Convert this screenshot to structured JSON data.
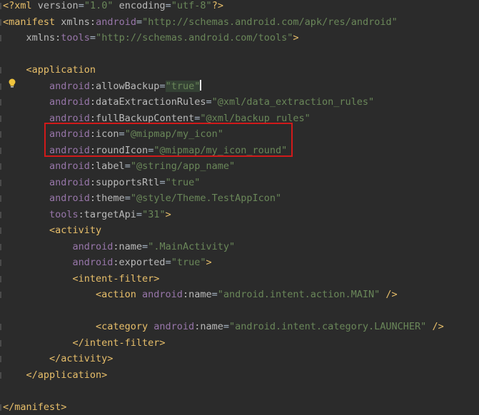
{
  "editor": {
    "lines": [
      {
        "indent": 0,
        "segments": [
          {
            "t": "<?xml ",
            "c": "tok-pi"
          },
          {
            "t": "version",
            "c": "tok-attr"
          },
          {
            "t": "=",
            "c": "tok-punct"
          },
          {
            "t": "\"1.0\"",
            "c": "tok-val"
          },
          {
            "t": " ",
            "c": "tok-punct"
          },
          {
            "t": "encoding",
            "c": "tok-attr"
          },
          {
            "t": "=",
            "c": "tok-punct"
          },
          {
            "t": "\"utf-8\"",
            "c": "tok-val"
          },
          {
            "t": "?>",
            "c": "tok-pi"
          }
        ]
      },
      {
        "indent": 0,
        "segments": [
          {
            "t": "<manifest ",
            "c": "tok-tag"
          },
          {
            "t": "xmlns:",
            "c": "tok-attr"
          },
          {
            "t": "android",
            "c": "tok-ns"
          },
          {
            "t": "=",
            "c": "tok-punct"
          },
          {
            "t": "\"http://schemas.android.com/apk/res/android\"",
            "c": "tok-val"
          }
        ]
      },
      {
        "indent": 1,
        "segments": [
          {
            "t": "xmlns:",
            "c": "tok-attr"
          },
          {
            "t": "tools",
            "c": "tok-ns"
          },
          {
            "t": "=",
            "c": "tok-punct"
          },
          {
            "t": "\"http://schemas.android.com/tools\"",
            "c": "tok-val"
          },
          {
            "t": ">",
            "c": "tok-tag"
          }
        ]
      },
      {
        "indent": 0,
        "segments": []
      },
      {
        "indent": 1,
        "segments": [
          {
            "t": "<application",
            "c": "tok-tag"
          }
        ]
      },
      {
        "indent": 2,
        "segments": [
          {
            "t": "android",
            "c": "tok-ns"
          },
          {
            "t": ":allowBackup",
            "c": "tok-attr"
          },
          {
            "t": "=",
            "c": "tok-punct"
          },
          {
            "t": "\"true\"",
            "c": "tok-val caret-hl"
          },
          {
            "t": "",
            "c": "caret"
          }
        ]
      },
      {
        "indent": 2,
        "segments": [
          {
            "t": "android",
            "c": "tok-ns"
          },
          {
            "t": ":dataExtractionRules",
            "c": "tok-attr"
          },
          {
            "t": "=",
            "c": "tok-punct"
          },
          {
            "t": "\"@xml/data_extraction_rules\"",
            "c": "tok-val"
          }
        ]
      },
      {
        "indent": 2,
        "segments": [
          {
            "t": "android",
            "c": "tok-ns"
          },
          {
            "t": ":fullBackupContent",
            "c": "tok-attr"
          },
          {
            "t": "=",
            "c": "tok-punct"
          },
          {
            "t": "\"@xml/backup_rules\"",
            "c": "tok-val"
          }
        ]
      },
      {
        "indent": 2,
        "segments": [
          {
            "t": "android",
            "c": "tok-ns"
          },
          {
            "t": ":icon",
            "c": "tok-attr"
          },
          {
            "t": "=",
            "c": "tok-punct"
          },
          {
            "t": "\"@mipmap/my_icon\"",
            "c": "tok-val"
          }
        ]
      },
      {
        "indent": 2,
        "segments": [
          {
            "t": "android",
            "c": "tok-ns"
          },
          {
            "t": ":roundIcon",
            "c": "tok-attr"
          },
          {
            "t": "=",
            "c": "tok-punct"
          },
          {
            "t": "\"@mipmap/my_icon_round\"",
            "c": "tok-val"
          }
        ]
      },
      {
        "indent": 2,
        "segments": [
          {
            "t": "android",
            "c": "tok-ns"
          },
          {
            "t": ":label",
            "c": "tok-attr"
          },
          {
            "t": "=",
            "c": "tok-punct"
          },
          {
            "t": "\"@string/app_name\"",
            "c": "tok-val"
          }
        ]
      },
      {
        "indent": 2,
        "segments": [
          {
            "t": "android",
            "c": "tok-ns"
          },
          {
            "t": ":supportsRtl",
            "c": "tok-attr"
          },
          {
            "t": "=",
            "c": "tok-punct"
          },
          {
            "t": "\"true\"",
            "c": "tok-val"
          }
        ]
      },
      {
        "indent": 2,
        "segments": [
          {
            "t": "android",
            "c": "tok-ns"
          },
          {
            "t": ":theme",
            "c": "tok-attr"
          },
          {
            "t": "=",
            "c": "tok-punct"
          },
          {
            "t": "\"@style/Theme.TestAppIcon\"",
            "c": "tok-val"
          }
        ]
      },
      {
        "indent": 2,
        "segments": [
          {
            "t": "tools",
            "c": "tok-ns"
          },
          {
            "t": ":targetApi",
            "c": "tok-attr"
          },
          {
            "t": "=",
            "c": "tok-punct"
          },
          {
            "t": "\"31\"",
            "c": "tok-val"
          },
          {
            "t": ">",
            "c": "tok-tag"
          }
        ]
      },
      {
        "indent": 2,
        "segments": [
          {
            "t": "<activity",
            "c": "tok-tag"
          }
        ]
      },
      {
        "indent": 3,
        "segments": [
          {
            "t": "android",
            "c": "tok-ns"
          },
          {
            "t": ":name",
            "c": "tok-attr"
          },
          {
            "t": "=",
            "c": "tok-punct"
          },
          {
            "t": "\".MainActivity\"",
            "c": "tok-val"
          }
        ]
      },
      {
        "indent": 3,
        "segments": [
          {
            "t": "android",
            "c": "tok-ns"
          },
          {
            "t": ":exported",
            "c": "tok-attr"
          },
          {
            "t": "=",
            "c": "tok-punct"
          },
          {
            "t": "\"true\"",
            "c": "tok-val"
          },
          {
            "t": ">",
            "c": "tok-tag"
          }
        ]
      },
      {
        "indent": 3,
        "segments": [
          {
            "t": "<intent-filter>",
            "c": "tok-tag"
          }
        ]
      },
      {
        "indent": 4,
        "segments": [
          {
            "t": "<action ",
            "c": "tok-tag"
          },
          {
            "t": "android",
            "c": "tok-ns"
          },
          {
            "t": ":name",
            "c": "tok-attr"
          },
          {
            "t": "=",
            "c": "tok-punct"
          },
          {
            "t": "\"android.intent.action.MAIN\"",
            "c": "tok-val"
          },
          {
            "t": " />",
            "c": "tok-tag"
          }
        ]
      },
      {
        "indent": 0,
        "segments": []
      },
      {
        "indent": 4,
        "segments": [
          {
            "t": "<category ",
            "c": "tok-tag"
          },
          {
            "t": "android",
            "c": "tok-ns"
          },
          {
            "t": ":name",
            "c": "tok-attr"
          },
          {
            "t": "=",
            "c": "tok-punct"
          },
          {
            "t": "\"android.intent.category.LAUNCHER\"",
            "c": "tok-val"
          },
          {
            "t": " />",
            "c": "tok-tag"
          }
        ]
      },
      {
        "indent": 3,
        "segments": [
          {
            "t": "</intent-filter>",
            "c": "tok-tag"
          }
        ]
      },
      {
        "indent": 2,
        "segments": [
          {
            "t": "</activity>",
            "c": "tok-tag"
          }
        ]
      },
      {
        "indent": 1,
        "segments": [
          {
            "t": "</application>",
            "c": "tok-tag"
          }
        ]
      },
      {
        "indent": 0,
        "segments": []
      },
      {
        "indent": 0,
        "segments": [
          {
            "t": "</manifest>",
            "c": "tok-tag"
          }
        ]
      }
    ],
    "highlight_color": "#d11a1a",
    "bulb_icon": "lightbulb-icon"
  }
}
